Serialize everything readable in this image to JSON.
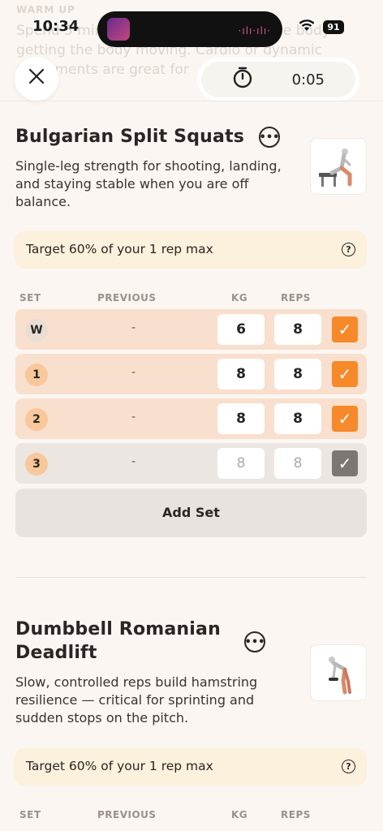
{
  "background_header": {
    "section_label": "WARM UP",
    "line1": "Spend 5 minutes warming up to get the body moving. Cardio or dynamic",
    "line2": "getting the body moving. Cardio or dynamic",
    "line3": "movements are great for"
  },
  "status_bar": {
    "time": "10:34",
    "battery": "91",
    "activity_wave": "·ılı·ılı·"
  },
  "timer": {
    "value": "0:05"
  },
  "exercises": [
    {
      "title": "Bulgarian Split Squats",
      "description": "Single-leg strength for shooting, landing, and staying stable when you are off balance.",
      "target": "Target 60% of your 1 rep max",
      "columns": {
        "set": "SET",
        "previous": "PREVIOUS",
        "kg": "KG",
        "reps": "REPS"
      },
      "sets": [
        {
          "label": "W",
          "previous": "-",
          "kg": "6",
          "reps": "8",
          "done": true
        },
        {
          "label": "1",
          "previous": "-",
          "kg": "8",
          "reps": "8",
          "done": true
        },
        {
          "label": "2",
          "previous": "-",
          "kg": "8",
          "reps": "8",
          "done": true
        },
        {
          "label": "3",
          "previous": "-",
          "kg": "8",
          "reps": "8",
          "done": false
        }
      ],
      "add_set_label": "Add Set"
    },
    {
      "title_line1": "Dumbbell Romanian",
      "title_line2": "Deadlift",
      "description": "Slow, controlled reps build hamstring resilience — critical for sprinting and sudden stops on the pitch.",
      "target": "Target 60% of your 1 rep max",
      "columns": {
        "set": "SET",
        "previous": "PREVIOUS",
        "kg": "KG",
        "reps": "REPS"
      }
    }
  ],
  "icons": {
    "close": "close-icon",
    "stopwatch": "stopwatch-icon",
    "more": "more-options-icon",
    "help": "help-icon",
    "check": "checkmark-icon"
  },
  "colors": {
    "accent": "#f6892a",
    "completed_row": "#f9dfcd",
    "pending_row": "#ebe6e2",
    "target_banner": "#fbf1dc",
    "background": "#fbf6f2"
  }
}
